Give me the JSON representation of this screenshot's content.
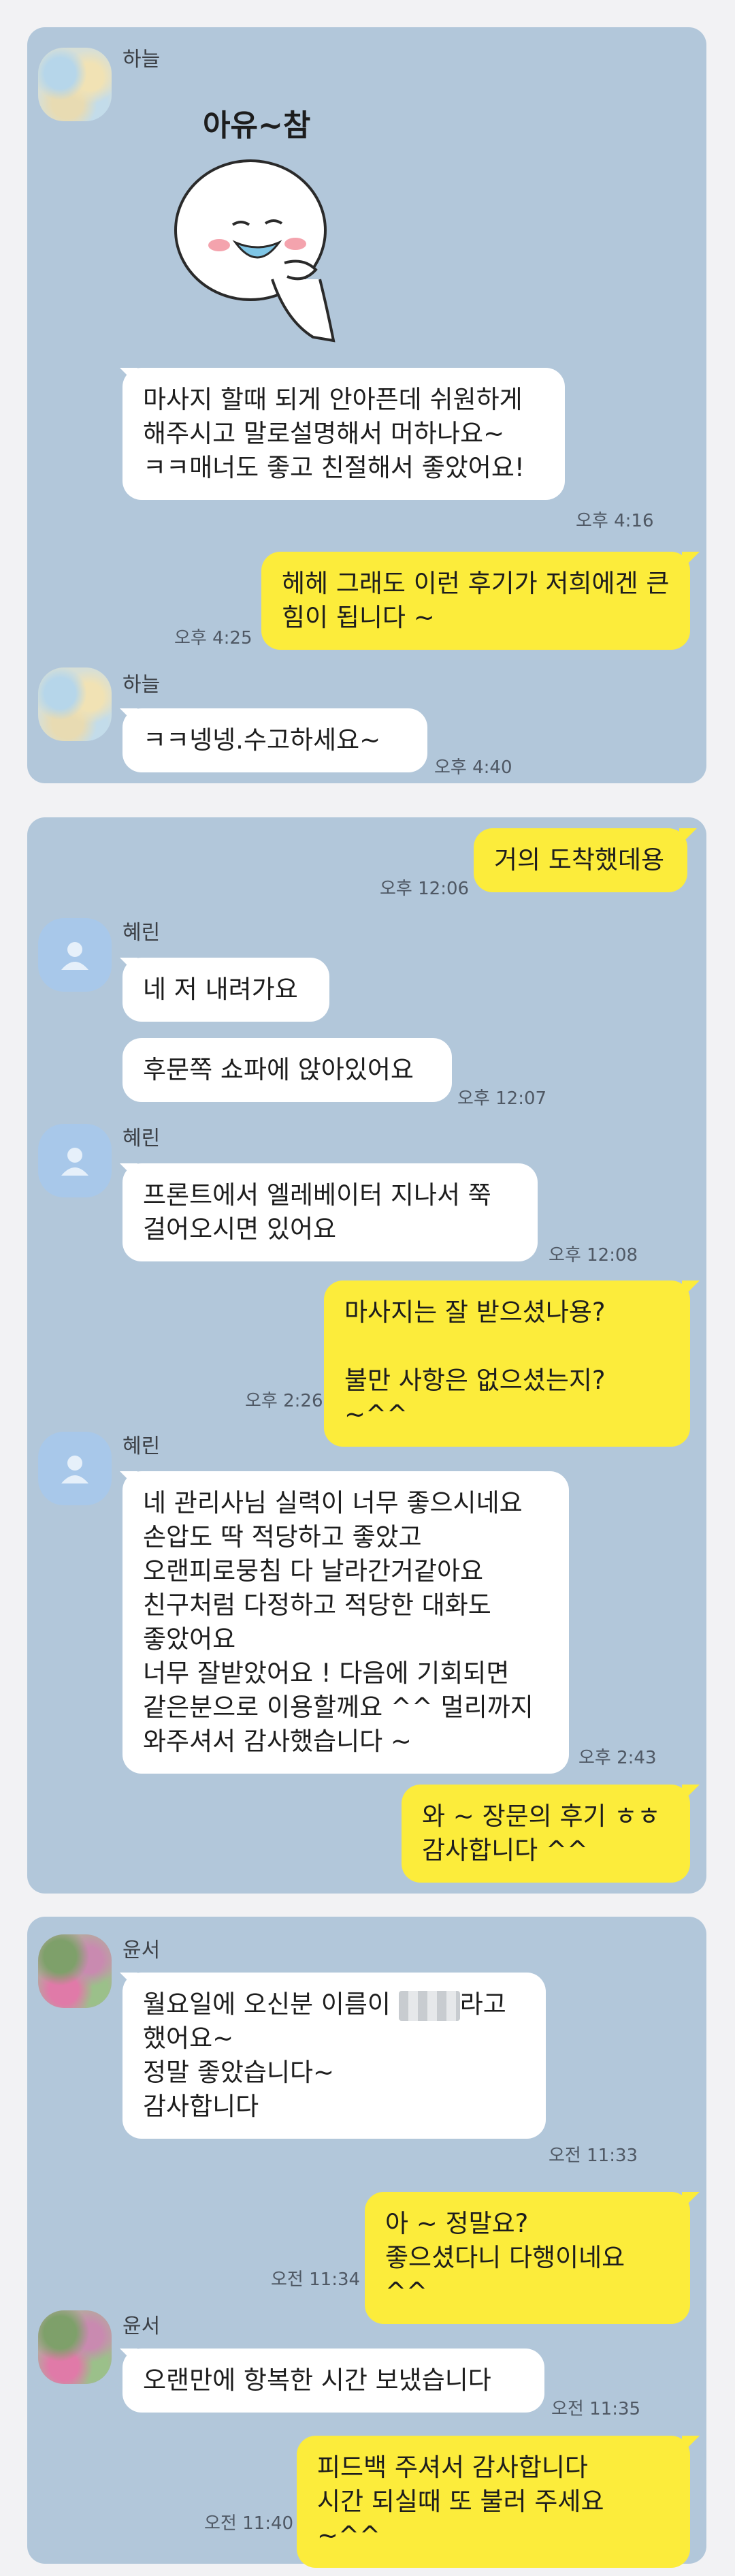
{
  "panel1": {
    "sender1": "하늘",
    "sticker_caption": "아유~참",
    "msg1": "마사지 할때 되게 안아픈데 쉬원하게 해주시고 말로설명해서 머하나요~ ㅋㅋ매너도 좋고 친절해서 좋았어요!",
    "time1": "오후 4:16",
    "reply1": "헤헤 그래도 이런 후기가 저희에겐 큰 힘이 됩니다 ~",
    "time2": "오후 4:25",
    "sender2": "하늘",
    "msg2": "ㅋㅋ넹넹.수고하세요~",
    "time3": "오후 4:40"
  },
  "panel2": {
    "out1": "거의 도착했데용",
    "time1": "오후 12:06",
    "sender1": "혜린",
    "msg1": "네 저 내려가요",
    "msg2": "후문쪽 쇼파에 앉아있어요",
    "time2": "오후 12:07",
    "sender2": "혜린",
    "msg3": "프론트에서 엘레베이터 지나서 쭉 걸어오시면 있어요",
    "time3": "오후 12:08",
    "out2": "마사지는 잘 받으셨나용?\n\n불만 사항은 없으셨는지? ~^^",
    "time4": "오후 2:26",
    "sender3": "혜린",
    "msg4": "네 관리사님 실력이 너무 좋으시네요\n손압도 딱 적당하고 좋았고\n오랜피로뭉침 다 날라간거같아요\n친구처럼 다정하고 적당한 대화도\n좋았어요\n너무 잘받았어요 ! 다음에 기회되면\n같은분으로 이용할께요 ^^ 멀리까지\n와주셔서 감사했습니다 ~",
    "time5": "오후 2:43",
    "out3": "와 ~ 장문의 후기 ㅎㅎ\n감사합니다 ^^"
  },
  "panel3": {
    "sender1": "윤서",
    "msg1_a": "월요일에 오신분 이름이 ",
    "msg1_b": "라고\n했어요~\n정말 좋았습니다~\n감사합니다",
    "time1": "오전 11:33",
    "out1": "아 ~ 정말요?\n좋으셨다니 다행이네요 ^^",
    "time2": "오전 11:34",
    "sender2": "윤서",
    "msg2": "오랜만에 항복한 시간 보냈습니다",
    "time3": "오전 11:35",
    "out2": "피드백 주셔서 감사합니다\n시간 되실때 또 불러 주세요 ~^^",
    "time4": "오전 11:40"
  },
  "colors": {
    "chat_bg": "#b2c7da",
    "incoming_bubble": "#ffffff",
    "outgoing_bubble": "#fcec3b"
  }
}
